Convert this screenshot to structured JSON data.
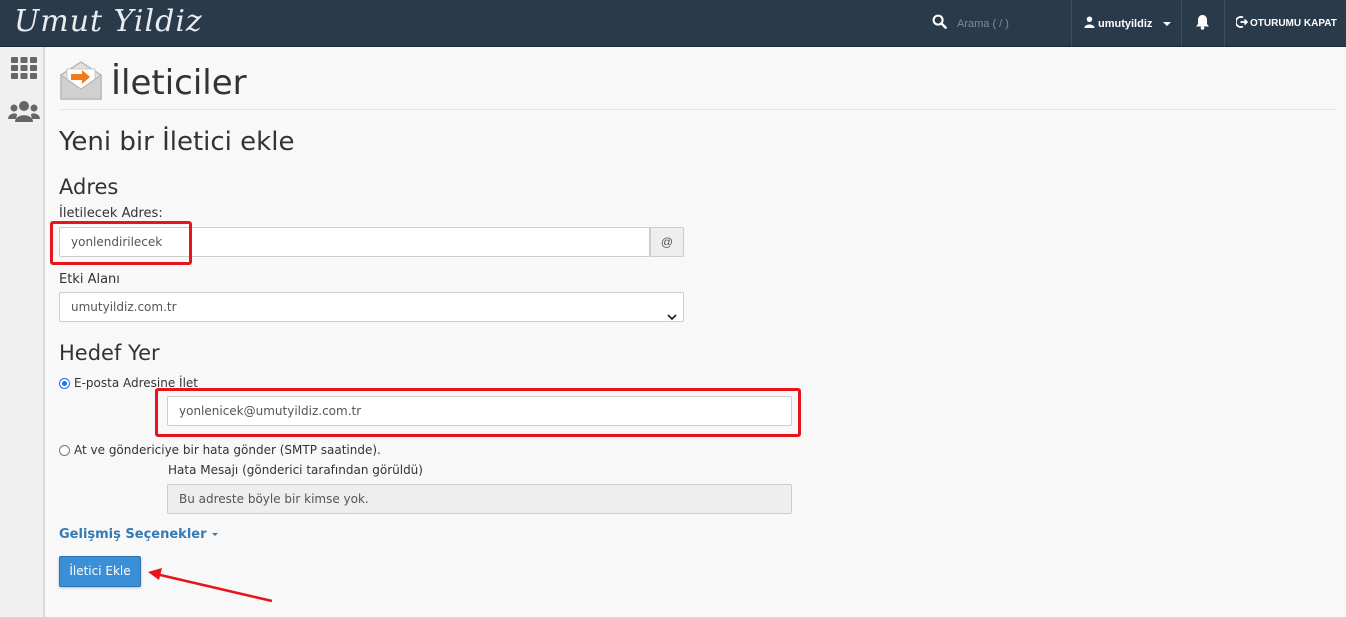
{
  "header": {
    "logo_text": "Umut Yildiz",
    "search_placeholder": "Arama ( / )",
    "username": "umutyildiz",
    "logout_label": "OTURUMU KAPAT"
  },
  "page": {
    "title": "İleticiler",
    "form_title": "Yeni bir İletici ekle"
  },
  "address": {
    "section_title": "Adres",
    "forward_label": "İletilecek Adres:",
    "forward_value": "yonlendirilecek",
    "at_symbol": "@",
    "domain_label": "Etki Alanı",
    "domain_value": "umutyildiz.com.tr"
  },
  "destination": {
    "section_title": "Hedef Yer",
    "option_email_label": "E-posta Adresine İlet",
    "email_value": "yonlenicek@umutyildiz.com.tr",
    "option_fail_label": "At ve göndericiye bir hata gönder (SMTP saatinde).",
    "error_message_label": "Hata Mesajı (gönderici tarafından görüldü)",
    "error_message_value": "Bu adreste böyle bir kimse yok."
  },
  "advanced_label": "Gelişmiş Seçenekler",
  "submit_label": "İletici Ekle",
  "colors": {
    "topbar": "#293a4a",
    "accent": "#337ab7",
    "button": "#3a8fd6",
    "annotation": "#e8141b"
  },
  "icons": [
    "search-icon",
    "user-icon",
    "bell-icon",
    "logout-icon",
    "grid-icon",
    "users-icon",
    "forwarder-icon",
    "chevron-down-icon"
  ]
}
